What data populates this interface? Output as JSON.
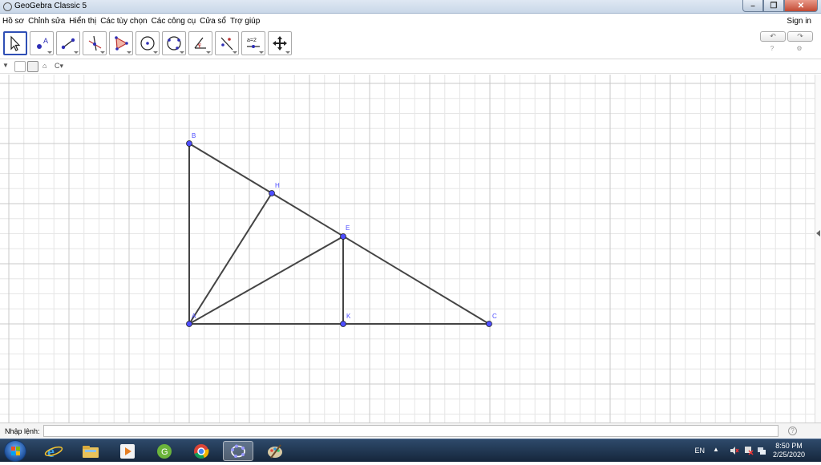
{
  "window": {
    "title": "GeoGebra Classic 5"
  },
  "menu": {
    "items": [
      "Hồ sơ",
      "Chỉnh sửa",
      "Hiển thị",
      "Các tùy chọn",
      "Các công cụ",
      "Cửa sổ",
      "Trợ giúp"
    ],
    "signin": "Sign in"
  },
  "toolbar": {
    "tools": [
      "move-tool",
      "point-tool",
      "segment-tool",
      "perpendicular-line-tool",
      "polygon-tool",
      "circle-tool",
      "ellipse-tool",
      "angle-tool",
      "reflect-tool",
      "slider-tool",
      "move-graphics-view-tool"
    ],
    "slider_label": "a=2",
    "undo": "↶",
    "redo": "↷"
  },
  "construction": {
    "points": {
      "B": {
        "label": "B"
      },
      "H": {
        "label": "H"
      },
      "E": {
        "label": "E"
      },
      "A": {
        "label": "A"
      },
      "K": {
        "label": "K"
      },
      "C": {
        "label": "C"
      }
    },
    "point_color": "#4d4dff",
    "segment_color": "#444444"
  },
  "inputbar": {
    "label": "Nhập lệnh:",
    "value": ""
  },
  "taskbar": {
    "lang": "EN",
    "time": "8:50 PM",
    "date": "2/25/2020"
  }
}
